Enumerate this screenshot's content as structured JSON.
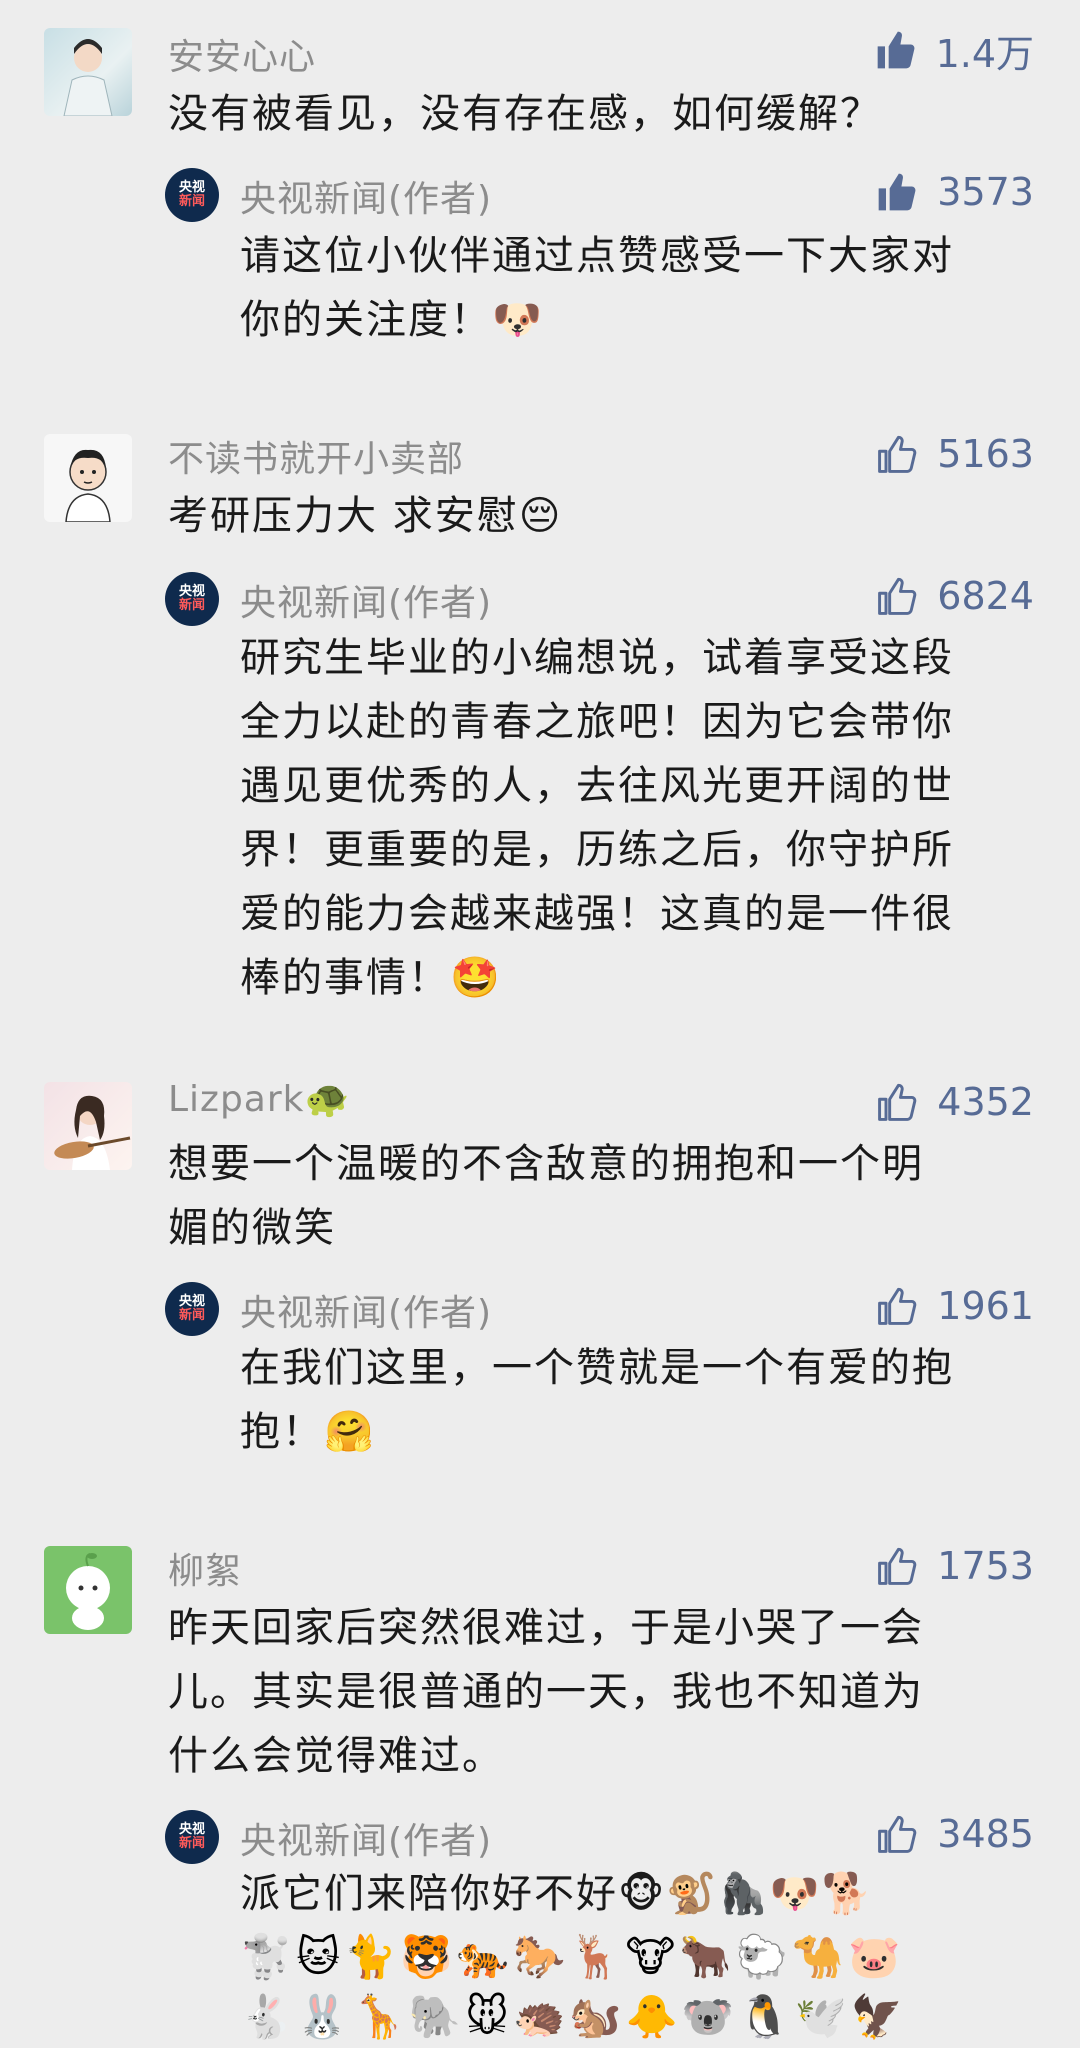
{
  "comments": [
    {
      "author": "安安心心",
      "likes": "1.4万",
      "liked": true,
      "lines": [
        "没有被看见，没有存在感，如何缓解？"
      ],
      "reply": {
        "author": "央视新闻(作者)",
        "likes": "3573",
        "liked": true,
        "lines": [
          "请这位小伙伴通过点赞感受一下大家对",
          "你的关注度！🐶"
        ]
      }
    },
    {
      "author": "不读书就开小卖部",
      "likes": "5163",
      "liked": false,
      "lines": [
        "考研压力大 求安慰😔"
      ],
      "reply": {
        "author": "央视新闻(作者)",
        "likes": "6824",
        "liked": false,
        "lines": [
          "研究生毕业的小编想说，试着享受这段",
          "全力以赴的青春之旅吧！因为它会带你",
          "遇见更优秀的人，去往风光更开阔的世",
          "界！更重要的是，历练之后，你守护所",
          "爱的能力会越来越强！这真的是一件很",
          "棒的事情！🤩"
        ]
      }
    },
    {
      "author": "Lizpark🐢",
      "likes": "4352",
      "liked": false,
      "lines": [
        "想要一个温暖的不含敌意的拥抱和一个明",
        "媚的微笑"
      ],
      "reply": {
        "author": "央视新闻(作者)",
        "likes": "1961",
        "liked": false,
        "lines": [
          "在我们这里，一个赞就是一个有爱的抱",
          "抱！🤗"
        ]
      }
    },
    {
      "author": "柳絮",
      "likes": "1753",
      "liked": false,
      "lines": [
        "昨天回家后突然很难过，于是小哭了一会",
        "儿。其实是很普通的一天，我也不知道为",
        "什么会觉得难过。"
      ],
      "reply": {
        "author": "央视新闻(作者)",
        "likes": "3485",
        "liked": false,
        "lines": [
          "派它们来陪你好不好🐵🐒🦍🐶🐕"
        ],
        "animals_row1": "🐩🐱🐈🐯🐅🐎🦌🐮🐂🐑🐪🐷",
        "animals_row2": "🐇🐰🦒🐘🐭🦔🐿️🐥🐨🐧🕊️🦅"
      }
    }
  ],
  "reply_avatar_text": [
    "央视",
    "新闻"
  ],
  "colors": {
    "like": "#576b95",
    "name": "#8c8c8c",
    "text": "#1a1a1a",
    "bg": "#ededed"
  }
}
